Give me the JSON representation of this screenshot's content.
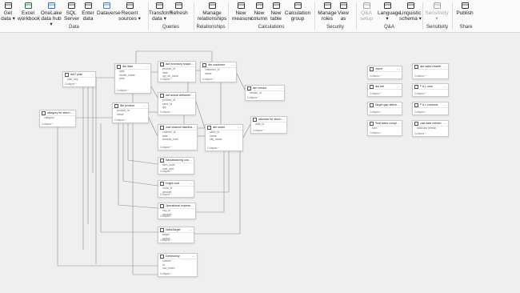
{
  "ribbon": {
    "buttons": [
      {
        "id": "get-data",
        "label": "Get data ▾",
        "icon": "database-icon",
        "color": "#333333",
        "disabled": false
      },
      {
        "id": "excel",
        "label": "Excel workbook",
        "icon": "excel-icon",
        "color": "#1e7145",
        "disabled": false
      },
      {
        "id": "onelake",
        "label": "OneLake data hub ▾",
        "icon": "onelake-icon",
        "color": "#2b6cd6",
        "disabled": false
      },
      {
        "id": "sql",
        "label": "SQL Server",
        "icon": "sql-server-icon",
        "color": "#333333",
        "disabled": false
      },
      {
        "id": "enter",
        "label": "Enter data",
        "icon": "table-icon",
        "color": "#333333",
        "disabled": false
      },
      {
        "id": "dataverse",
        "label": "Dataverse",
        "icon": "dataverse-icon",
        "color": "#3a7de0",
        "disabled": false
      },
      {
        "id": "recent",
        "label": "Recent sources ▾",
        "icon": "recent-icon",
        "color": "#333333",
        "disabled": false
      },
      {
        "id": "transform",
        "label": "Transform data ▾",
        "icon": "transform-icon",
        "color": "#333333",
        "disabled": false
      },
      {
        "id": "refresh",
        "label": "Refresh",
        "icon": "refresh-icon",
        "color": "#333333",
        "disabled": false
      },
      {
        "id": "manage-rel",
        "label": "Manage relationships",
        "icon": "relationships-icon",
        "color": "#333333",
        "disabled": false
      },
      {
        "id": "new-measure",
        "label": "New measure",
        "icon": "measure-icon",
        "color": "#333333",
        "disabled": false
      },
      {
        "id": "new-column",
        "label": "New column",
        "icon": "column-icon",
        "color": "#333333",
        "disabled": false
      },
      {
        "id": "new-table",
        "label": "New table",
        "icon": "new-table-icon",
        "color": "#333333",
        "disabled": false
      },
      {
        "id": "calc-group",
        "label": "Calculation group",
        "icon": "calc-group-icon",
        "color": "#333333",
        "disabled": false
      },
      {
        "id": "manage-roles",
        "label": "Manage roles",
        "icon": "roles-icon",
        "color": "#333333",
        "disabled": false
      },
      {
        "id": "view-as",
        "label": "View as",
        "icon": "view-as-icon",
        "color": "#333333",
        "disabled": false
      },
      {
        "id": "qa-setup",
        "label": "Q&A setup",
        "icon": "qa-icon",
        "color": "#a8a8a8",
        "disabled": true
      },
      {
        "id": "language",
        "label": "Language ▾",
        "icon": "language-icon",
        "color": "#333333",
        "disabled": false
      },
      {
        "id": "ling-schema",
        "label": "Linguistic schema ▾",
        "icon": "linguistic-icon",
        "color": "#333333",
        "disabled": false
      },
      {
        "id": "sensitivity",
        "label": "Sensitivity ▾",
        "icon": "sensitivity-icon",
        "color": "#a8a8a8",
        "disabled": true
      },
      {
        "id": "publish",
        "label": "Publish",
        "icon": "publish-icon",
        "color": "#333333",
        "disabled": false
      }
    ],
    "groups": [
      {
        "label": "Data"
      },
      {
        "label": "Queries"
      },
      {
        "label": "Relationships"
      },
      {
        "label": "Calculations"
      },
      {
        "label": "Security"
      },
      {
        "label": "Q&A"
      },
      {
        "label": "Sensitivity"
      },
      {
        "label": "Share"
      }
    ]
  },
  "tables": [
    {
      "id": "t1",
      "name": "fact7 plan",
      "rows": [
        "plan_key"
      ],
      "footer": "Collapse ^"
    },
    {
      "id": "t2",
      "name": "category for store health",
      "rows": [
        "category"
      ],
      "footer": "Collapse ^"
    },
    {
      "id": "t3",
      "name": "dim date",
      "rows": [
        "date",
        "month_name",
        "year"
      ],
      "footer": "Collapse ^"
    },
    {
      "id": "t4",
      "name": "dim product",
      "rows": [
        "product_id",
        "name"
      ],
      "footer": "Collapse ^"
    },
    {
      "id": "t5",
      "name": "fact inventory snapshot",
      "rows": [
        "product_id",
        "date",
        "qty_on_hand"
      ],
      "footer": "Collapse ^"
    },
    {
      "id": "t6",
      "name": "fact actual deliveries",
      "rows": [
        "product_id",
        "store_id",
        "qty"
      ],
      "footer": "Collapse ^"
    },
    {
      "id": "t7",
      "name": "dim customer",
      "rows": [
        "customer_id",
        "name"
      ],
      "footer": "Collapse ^"
    },
    {
      "id": "t8",
      "name": "dim vendor",
      "rows": [
        "vendor_id"
      ],
      "footer": "Collapse ^"
    },
    {
      "id": "t9",
      "name": "post channel distribution",
      "rows": [
        "channel_id",
        "date",
        "amount_total"
      ],
      "footer": "Collapse ^"
    },
    {
      "id": "t10",
      "name": "dim outlet",
      "rows": [
        "store_id",
        "name",
        "city_name"
      ],
      "footer": "Collapse ^"
    },
    {
      "id": "t11",
      "name": "calendar for store model",
      "rows": [
        "date_id"
      ],
      "footer": "Collapse ^"
    },
    {
      "id": "t12",
      "name": "Manufacturing cost",
      "rows": [
        "item_code",
        "cost_amt"
      ],
      "footer": "Collapse ^"
    },
    {
      "id": "t13",
      "name": "freight cost",
      "rows": [
        "route_id",
        "amount"
      ],
      "footer": "Collapse ^"
    },
    {
      "id": "t14",
      "name": "Operational expense",
      "rows": [
        "exp_id",
        "amount"
      ],
      "footer": "Collapse ^"
    },
    {
      "id": "t15",
      "name": "SalesTarget",
      "rows": [
        "target",
        "period"
      ],
      "footer": "Collapse ^"
    },
    {
      "id": "t16",
      "name": "Zrefreshmy",
      "rows": [
        "column",
        "id",
        "row_index"
      ],
      "footer": "Collapse ^"
    },
    {
      "id": "t17",
      "name": "report",
      "rows": [],
      "footer": "Collapse ^"
    },
    {
      "id": "t18",
      "name": "last refr",
      "rows": [],
      "footer": "Collapse ^"
    },
    {
      "id": "t19",
      "name": "Target gap deliveries",
      "rows": [],
      "footer": "Collapse ^"
    },
    {
      "id": "t20",
      "name": "Real sales complete",
      "rows": [
        "sum"
      ],
      "footer": "Collapse ^"
    },
    {
      "id": "t21",
      "name": "last sales rewrite",
      "rows": [],
      "footer": "Collapse ^"
    },
    {
      "id": "t22",
      "name": "P & L sum",
      "rows": [],
      "footer": "Collapse ^"
    },
    {
      "id": "t23",
      "name": "P & L columns",
      "rows": [],
      "footer": "Collapse ^"
    },
    {
      "id": "t24",
      "name": "Last data refresh",
      "rows": [
        "data last refresh"
      ],
      "footer": "Collapse ^"
    }
  ]
}
